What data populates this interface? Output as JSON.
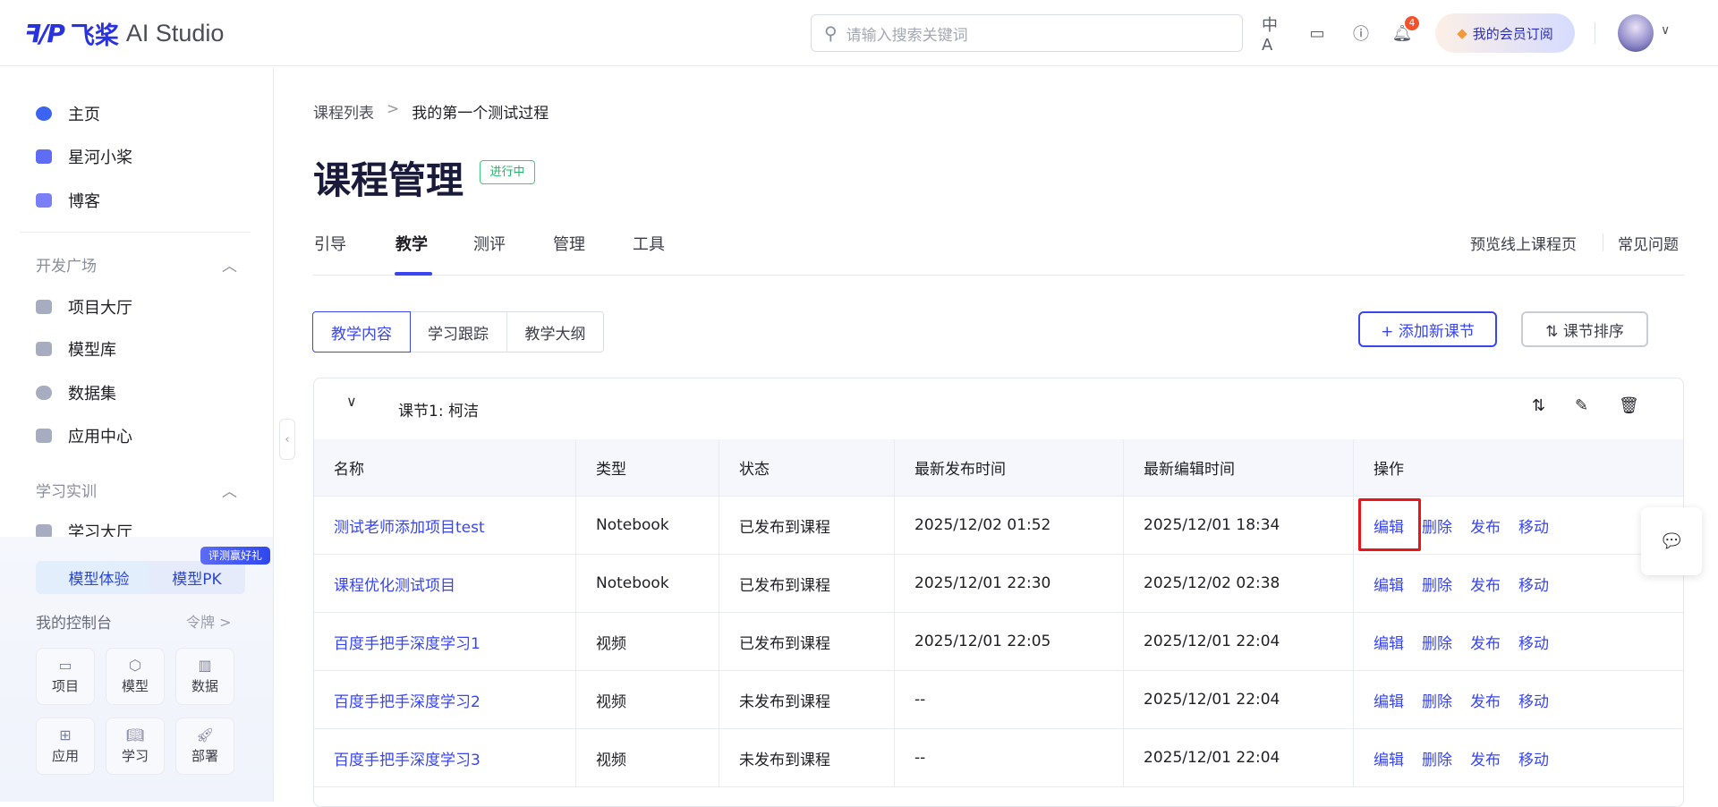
{
  "header": {
    "logo_mark": "ꟻ/P",
    "logo_cn": "飞桨",
    "logo_en": "AI Studio",
    "search_placeholder": "请输入搜索关键词",
    "notification_count": "4",
    "member_label": "我的会员订阅",
    "icons": [
      "translate-icon",
      "monitor-icon",
      "help-icon",
      "bell-icon"
    ]
  },
  "sidebar": {
    "top_items": [
      {
        "label": "主页",
        "color": "#3c63f2"
      },
      {
        "label": "星河小桨",
        "color": "#5f6cf6"
      },
      {
        "label": "博客",
        "color": "#7b7ff5"
      }
    ],
    "groups": [
      {
        "title": "开发广场",
        "items": [
          "项目大厅",
          "模型库",
          "数据集",
          "应用中心"
        ]
      },
      {
        "title": "学习实训",
        "items": [
          "学习大厅"
        ]
      }
    ],
    "promo": {
      "experience": "模型体验",
      "pk": "模型PK",
      "pk_badge": "评测赢好礼"
    },
    "console": {
      "title": "我的控制台",
      "token": "令牌 >",
      "tiles": [
        {
          "label": "项目",
          "icon": "folder-icon"
        },
        {
          "label": "模型",
          "icon": "cube-icon"
        },
        {
          "label": "数据",
          "icon": "bar-chart-icon"
        },
        {
          "label": "应用",
          "icon": "apps-icon"
        },
        {
          "label": "学习",
          "icon": "book-icon"
        },
        {
          "label": "部署",
          "icon": "rocket-icon"
        }
      ]
    }
  },
  "breadcrumb": {
    "parent": "课程列表",
    "separator": ">",
    "current": "我的第一个测试过程"
  },
  "page": {
    "title": "课程管理",
    "status": "进行中"
  },
  "tabs": [
    "引导",
    "教学",
    "测评",
    "管理",
    "工具"
  ],
  "active_tab": "教学",
  "right_links": [
    "预览线上课程页",
    "常见问题"
  ],
  "segments": [
    "教学内容",
    "学习跟踪",
    "教学大纲"
  ],
  "actions": {
    "add": "+ 添加新课节",
    "sort": "⇅ 课节排序"
  },
  "section": {
    "title": "课节1: 柯洁"
  },
  "table": {
    "columns": [
      "名称",
      "类型",
      "状态",
      "最新发布时间",
      "最新编辑时间",
      "操作"
    ],
    "rows": [
      [
        "测试老师添加项目test",
        "Notebook",
        "已发布到课程",
        "2025/12/02 01:52",
        "2025/12/01 18:34"
      ],
      [
        "课程优化测试项目",
        "Notebook",
        "已发布到课程",
        "2025/12/01 22:30",
        "2025/12/02 02:38"
      ],
      [
        "百度手把手深度学习1",
        "视频",
        "已发布到课程",
        "2025/12/01 22:05",
        "2025/12/01 22:04"
      ],
      [
        "百度手把手深度学习2",
        "视频",
        "未发布到课程",
        "--",
        "2025/12/01 22:04"
      ],
      [
        "百度手把手深度学习3",
        "视频",
        "未发布到课程",
        "--",
        "2025/12/01 22:04"
      ]
    ],
    "row_actions": [
      "编辑",
      "删除",
      "发布",
      "移动"
    ]
  },
  "colors": {
    "accent": "#3845f0",
    "status_green": "#21b46a",
    "highlight": "#e8151b"
  }
}
